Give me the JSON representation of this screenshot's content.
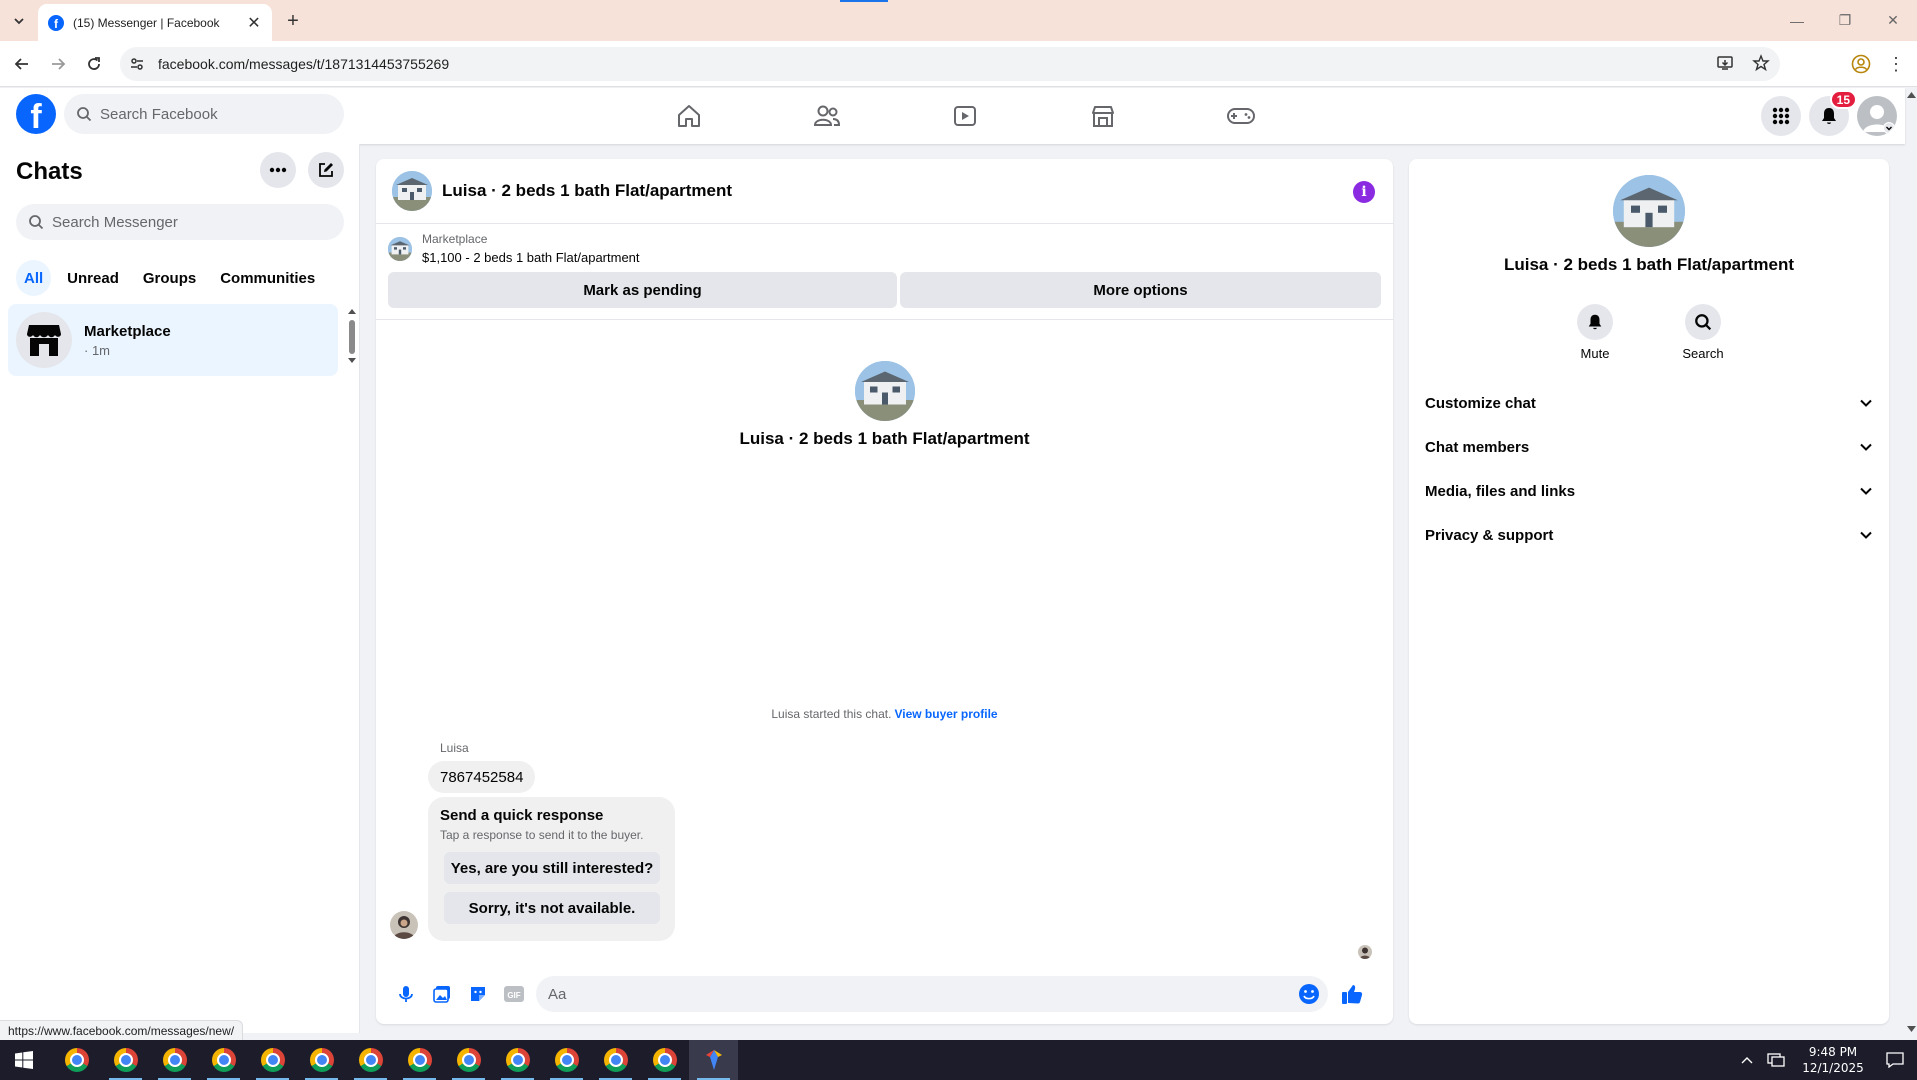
{
  "browser": {
    "tab_title": "(15) Messenger | Facebook",
    "url": "facebook.com/messages/t/1871314453755269",
    "status_url": "https://www.facebook.com/messages/new/"
  },
  "header": {
    "search_placeholder": "Search Facebook",
    "notification_count": "15",
    "nav": [
      "home-icon",
      "friends-icon",
      "video-icon",
      "marketplace-icon",
      "gaming-icon"
    ]
  },
  "chats": {
    "title": "Chats",
    "search_placeholder": "Search Messenger",
    "filters": [
      "All",
      "Unread",
      "Groups",
      "Communities"
    ],
    "active_filter": "All",
    "items": [
      {
        "name": "Marketplace",
        "time": "· 1m"
      }
    ]
  },
  "conversation": {
    "title": "Luisa · 2 beds 1 bath Flat/apartment",
    "marketplace_label": "Marketplace",
    "listing": "$1,100 - 2 beds 1 bath Flat/apartment",
    "buttons": {
      "mark_pending": "Mark as pending",
      "more_options": "More options"
    },
    "intro_name": "Luisa · 2 beds 1 bath Flat/apartment",
    "started_text": "Luisa started this chat.",
    "view_profile": "View buyer profile",
    "sender": "Luisa",
    "message": "7867452584",
    "quick_response": {
      "title": "Send a quick response",
      "subtitle": "Tap a response to send it to the buyer.",
      "options": [
        "Yes, are you still interested?",
        "Sorry, it's not available."
      ]
    },
    "composer_placeholder": "Aa"
  },
  "details": {
    "name": "Luisa · 2 beds 1 bath Flat/apartment",
    "actions": {
      "mute": "Mute",
      "search": "Search"
    },
    "sections": [
      "Customize chat",
      "Chat members",
      "Media, files and links",
      "Privacy & support"
    ]
  },
  "taskbar": {
    "time": "9:48 PM",
    "date": "12/1/2025"
  },
  "colors": {
    "facebook_blue": "#0866ff",
    "tab_strip": "#f7e2da",
    "info_purple": "#8a2be2",
    "badge_red": "#e41e3f"
  }
}
